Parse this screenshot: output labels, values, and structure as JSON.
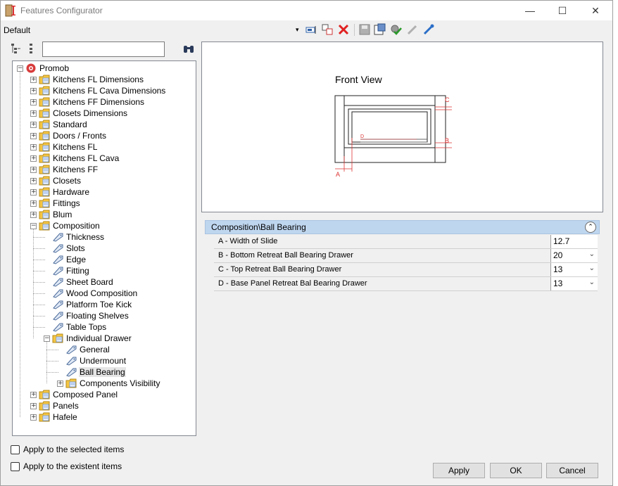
{
  "window": {
    "title": "Features Configurator",
    "profile": "Default"
  },
  "toolbar": {
    "dropdown_caret": "▾"
  },
  "search": {
    "value": ""
  },
  "tree": [
    {
      "label": "Promob",
      "icon": "promob-logo-icon",
      "level": 0,
      "expand": "−"
    },
    {
      "label": "Kitchens FL Dimensions",
      "icon": "folder-icon",
      "level": 1,
      "expand": "+"
    },
    {
      "label": "Kitchens FL Cava Dimensions",
      "icon": "folder-icon",
      "level": 1,
      "expand": "+"
    },
    {
      "label": "Kitchens FF Dimensions",
      "icon": "folder-icon",
      "level": 1,
      "expand": "+"
    },
    {
      "label": "Closets Dimensions",
      "icon": "folder-icon",
      "level": 1,
      "expand": "+"
    },
    {
      "label": "Standard",
      "icon": "folder-icon",
      "level": 1,
      "expand": "+"
    },
    {
      "label": "Doors / Fronts",
      "icon": "folder-icon",
      "level": 1,
      "expand": "+"
    },
    {
      "label": "Kitchens FL",
      "icon": "folder-icon",
      "level": 1,
      "expand": "+"
    },
    {
      "label": "Kitchens FL Cava",
      "icon": "folder-icon",
      "level": 1,
      "expand": "+"
    },
    {
      "label": "Kitchens FF",
      "icon": "folder-icon",
      "level": 1,
      "expand": "+"
    },
    {
      "label": "Closets",
      "icon": "folder-icon",
      "level": 1,
      "expand": "+"
    },
    {
      "label": "Hardware",
      "icon": "folder-icon",
      "level": 1,
      "expand": "+"
    },
    {
      "label": "Fittings",
      "icon": "folder-icon",
      "level": 1,
      "expand": "+"
    },
    {
      "label": "Blum",
      "icon": "folder-icon",
      "level": 1,
      "expand": "+"
    },
    {
      "label": "Composition",
      "icon": "folder-open-icon",
      "level": 1,
      "expand": "−"
    },
    {
      "label": "Thickness",
      "icon": "tag-icon",
      "level": 2,
      "expand": ""
    },
    {
      "label": "Slots",
      "icon": "tag-icon",
      "level": 2,
      "expand": ""
    },
    {
      "label": "Edge",
      "icon": "tag-icon",
      "level": 2,
      "expand": ""
    },
    {
      "label": "Fitting",
      "icon": "tag-icon",
      "level": 2,
      "expand": ""
    },
    {
      "label": "Sheet Board",
      "icon": "tag-icon",
      "level": 2,
      "expand": ""
    },
    {
      "label": "Wood Composition",
      "icon": "tag-icon",
      "level": 2,
      "expand": ""
    },
    {
      "label": "Platform Toe Kick",
      "icon": "tag-icon",
      "level": 2,
      "expand": ""
    },
    {
      "label": "Floating Shelves",
      "icon": "tag-icon",
      "level": 2,
      "expand": ""
    },
    {
      "label": "Table Tops",
      "icon": "tag-icon",
      "level": 2,
      "expand": ""
    },
    {
      "label": "Individual Drawer",
      "icon": "folder-open-icon",
      "level": 2,
      "expand": "−"
    },
    {
      "label": "General",
      "icon": "tag-icon",
      "level": 3,
      "expand": ""
    },
    {
      "label": "Undermount",
      "icon": "tag-icon",
      "level": 3,
      "expand": ""
    },
    {
      "label": "Ball Bearing",
      "icon": "tag-icon",
      "level": 3,
      "expand": "",
      "selected": true
    },
    {
      "label": "Components Visibility",
      "icon": "folder-icon",
      "level": 3,
      "expand": "+"
    },
    {
      "label": "Composed Panel",
      "icon": "folder-icon",
      "level": 1,
      "expand": "+"
    },
    {
      "label": "Panels",
      "icon": "folder-icon",
      "level": 1,
      "expand": "+"
    },
    {
      "label": "Hafele",
      "icon": "folder-icon",
      "level": 1,
      "expand": "+"
    }
  ],
  "preview": {
    "title": "Front View",
    "labels": {
      "a": "A",
      "b": "B",
      "c": "C",
      "d": "D"
    }
  },
  "properties": {
    "header": "Composition\\Ball Bearing",
    "rows": [
      {
        "label": "A - Width of Slide",
        "value": "12.7",
        "dropdown": false
      },
      {
        "label": "B - Bottom Retreat Ball Bearing Drawer",
        "value": "20",
        "dropdown": true
      },
      {
        "label": "C - Top Retreat Ball Bearing Drawer",
        "value": "13",
        "dropdown": true
      },
      {
        "label": "D - Base Panel Retreat Bal Bearing Drawer",
        "value": "13",
        "dropdown": true
      }
    ]
  },
  "options": {
    "apply_selected": "Apply to the selected items",
    "apply_existent": "Apply to the existent items"
  },
  "buttons": {
    "apply": "Apply",
    "ok": "OK",
    "cancel": "Cancel"
  },
  "colors": {
    "accent_red": "#d83b3b",
    "folder": "#f5c542",
    "header_blue": "#bfd6ef"
  }
}
